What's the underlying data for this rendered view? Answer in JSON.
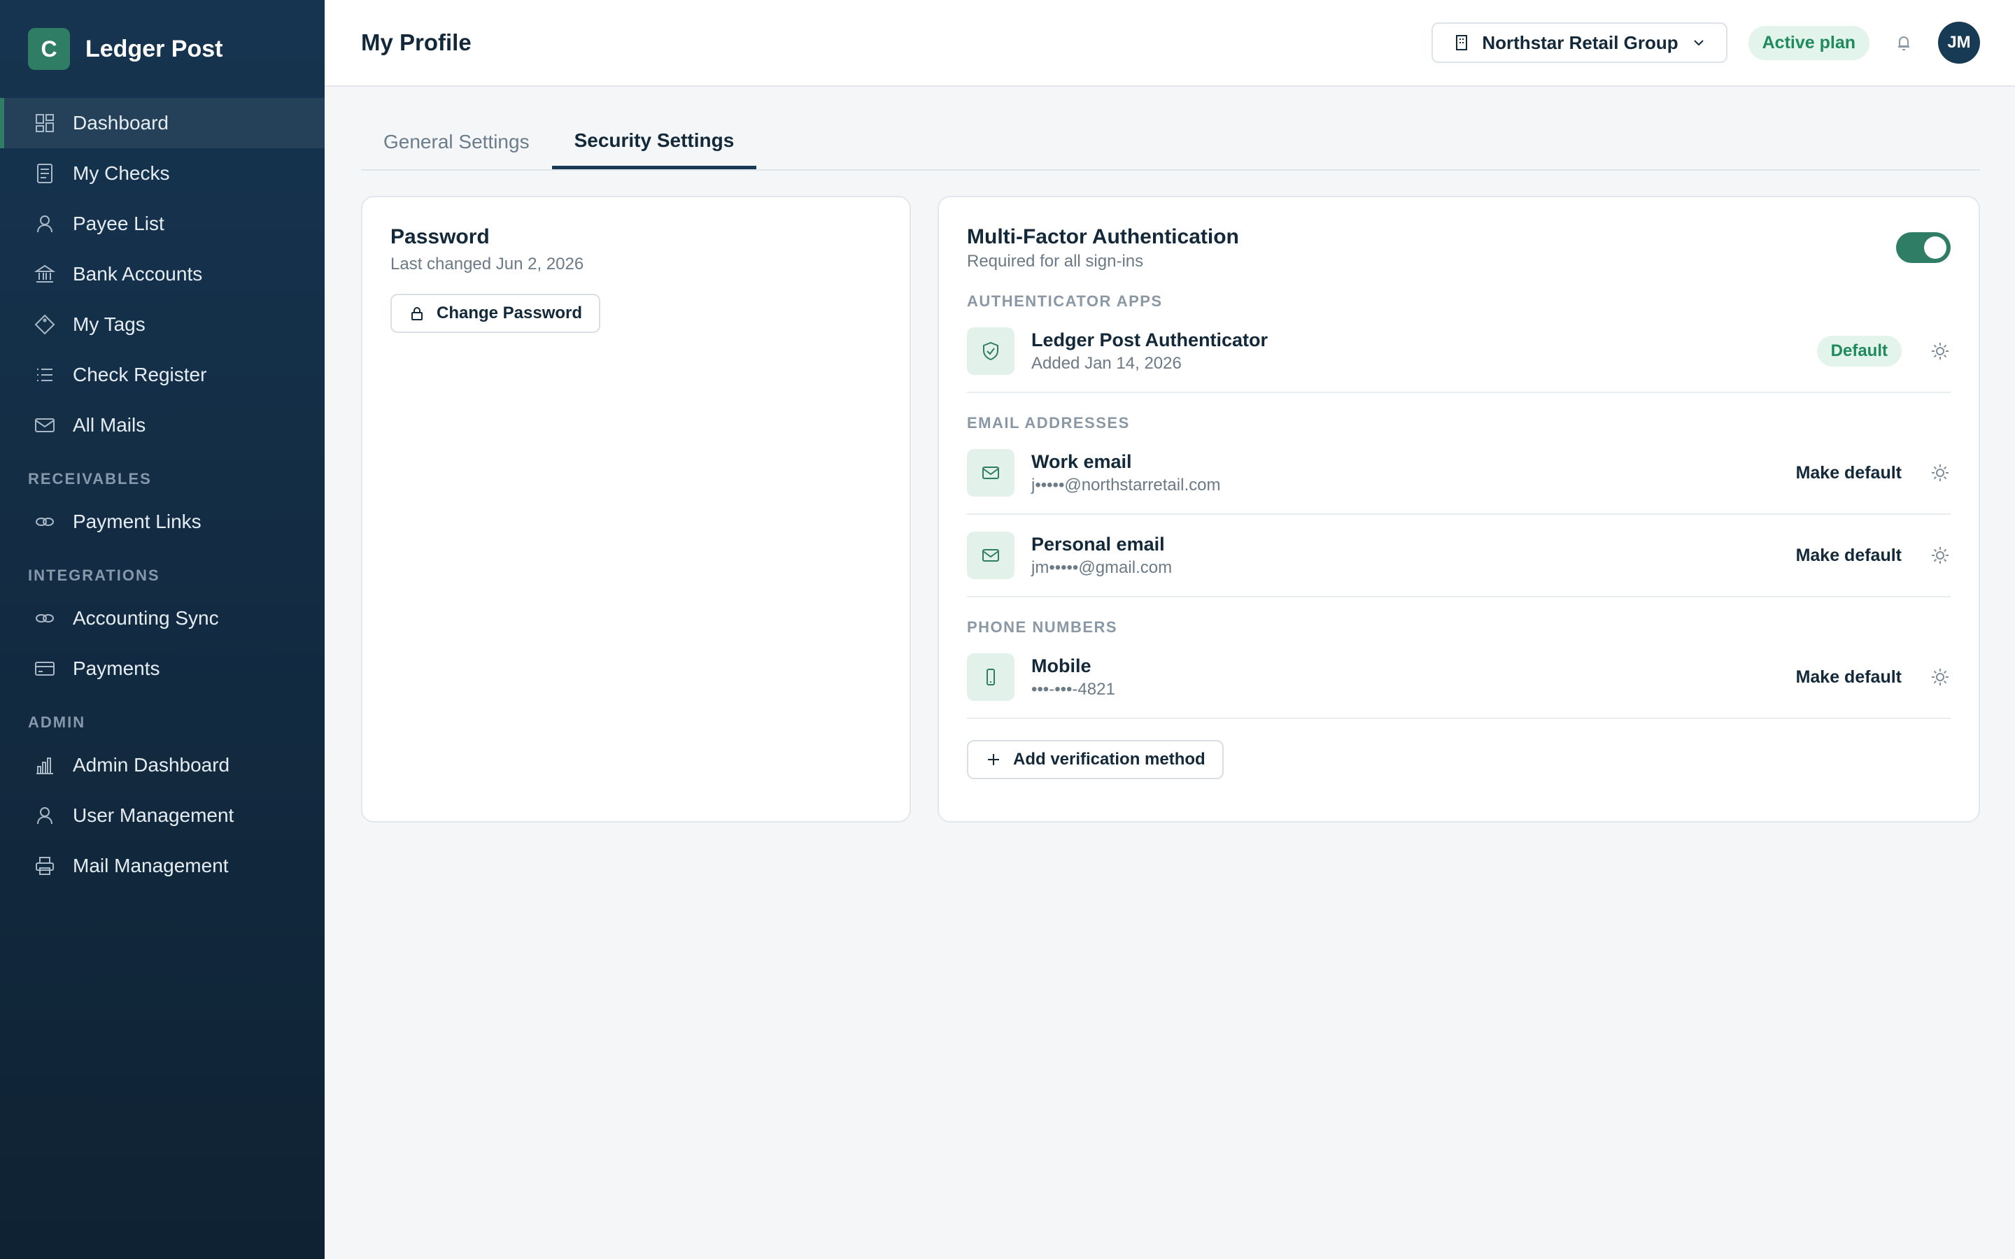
{
  "brand": {
    "logo_letter": "C",
    "name": "Ledger Post"
  },
  "sidebar": {
    "items": [
      {
        "label": "Dashboard",
        "icon": "dashboard-icon",
        "active": true
      },
      {
        "label": "My Checks",
        "icon": "document-icon"
      },
      {
        "label": "Payee List",
        "icon": "user-icon"
      },
      {
        "label": "Bank Accounts",
        "icon": "bank-icon"
      },
      {
        "label": "My Tags",
        "icon": "tag-icon"
      },
      {
        "label": "Check Register",
        "icon": "list-icon"
      },
      {
        "label": "All Mails",
        "icon": "mail-icon"
      }
    ],
    "sections": [
      {
        "title": "RECEIVABLES",
        "items": [
          {
            "label": "Payment Links",
            "icon": "link-icon"
          }
        ]
      },
      {
        "title": "INTEGRATIONS",
        "items": [
          {
            "label": "Accounting Sync",
            "icon": "link-icon"
          },
          {
            "label": "Payments",
            "icon": "card-icon"
          }
        ]
      },
      {
        "title": "ADMIN",
        "items": [
          {
            "label": "Admin Dashboard",
            "icon": "bar-chart-icon"
          },
          {
            "label": "User Management",
            "icon": "user-icon"
          },
          {
            "label": "Mail Management",
            "icon": "printer-icon"
          }
        ]
      }
    ]
  },
  "header": {
    "title": "My Profile",
    "org": "Northstar Retail Group",
    "plan": "Active plan",
    "avatar": "JM"
  },
  "tabs": [
    {
      "label": "General Settings",
      "active": false
    },
    {
      "label": "Security Settings",
      "active": true
    }
  ],
  "password": {
    "title": "Password",
    "last_changed": "Last changed Jun 2, 2026",
    "button": "Change Password"
  },
  "mfa": {
    "title": "Multi-Factor Authentication",
    "subtitle": "Required for all sign-ins",
    "enabled": true,
    "auth_apps_label": "AUTHENTICATOR APPS",
    "auth_app": {
      "name": "Ledger Post Authenticator",
      "detail": "Added Jan 14, 2026",
      "badge": "Default"
    },
    "email_label": "EMAIL ADDRESSES",
    "emails": [
      {
        "name": "Work email",
        "detail": "j•••••@northstarretail.com",
        "action": "Make default"
      },
      {
        "name": "Personal email",
        "detail": "jm•••••@gmail.com",
        "action": "Make default"
      }
    ],
    "phone_label": "PHONE NUMBERS",
    "phone": {
      "name": "Mobile",
      "detail": "•••-•••-4821",
      "action": "Make default"
    },
    "add_button": "Add verification method"
  },
  "colors": {
    "accent": "#2f7d64",
    "sidebar_bg": "#163450",
    "badge_bg": "#e3f4ec",
    "badge_text": "#1f8a5c"
  }
}
